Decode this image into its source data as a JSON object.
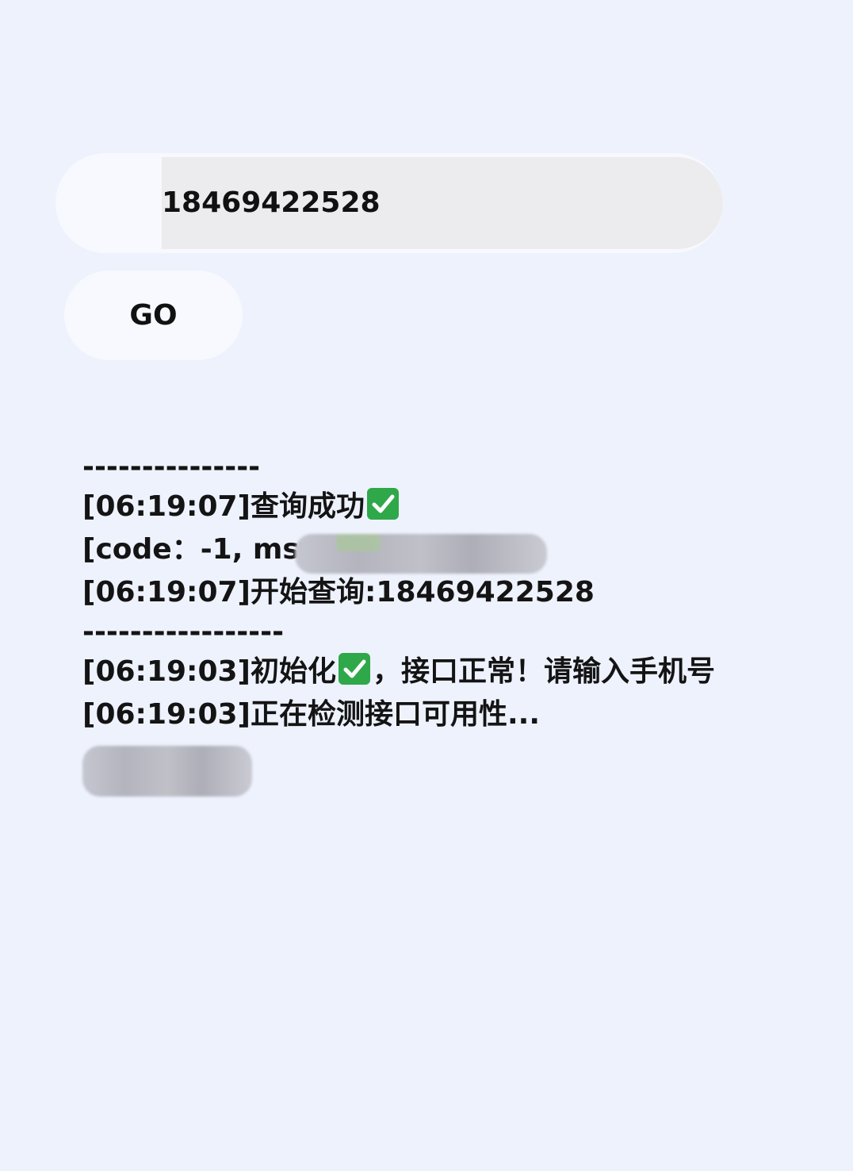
{
  "phone_input": {
    "value": "18469422528"
  },
  "go_button": {
    "label": "GO"
  },
  "log": {
    "sep1": "---------------",
    "line1_text": "[06:19:07]查询成功",
    "line2_text": "[code：-1, msg：",
    "line3_text": "[06:19:07]开始查询:18469422528",
    "sep2": "-----------------",
    "line4_prefix": "[06:19:03]初始化",
    "line4_suffix": "，接口正常！请输入手机号",
    "line5_text": "[06:19:03]正在检测接口可用性..."
  },
  "icons": {
    "check": "check-mark-button-icon"
  },
  "colors": {
    "background": "#eef2fd",
    "input_bg": "#ececee",
    "button_bg": "#f7f9fe",
    "check_green": "#2fa84a",
    "text": "#111111"
  }
}
